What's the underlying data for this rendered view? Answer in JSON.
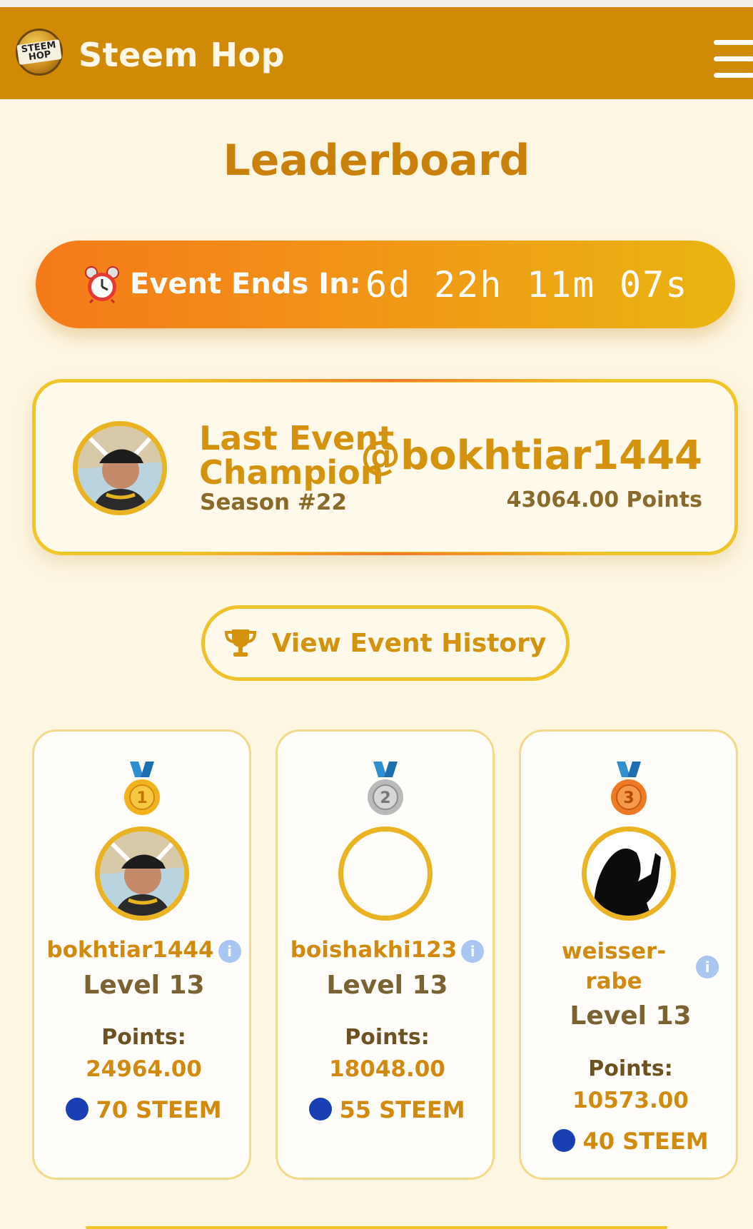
{
  "header": {
    "app_title": "Steem Hop",
    "logo_text": "STEEM HOP",
    "bg_color": "#d18a06"
  },
  "page": {
    "title": "Leaderboard"
  },
  "countdown": {
    "label": "Event Ends In:",
    "days": "6d",
    "hours": "22h",
    "minutes": "11m",
    "seconds": "07s",
    "icon": "alarm-clock-icon"
  },
  "champion": {
    "heading": "Last Event Champion",
    "season": "Season #22",
    "username": "@bokhtiar1444",
    "points": "43064.00 Points"
  },
  "history_button": {
    "label": "View Event History",
    "icon": "trophy-icon"
  },
  "leaders": [
    {
      "rank": "1",
      "username": "bokhtiar1444",
      "level": "Level 13",
      "points_label": "Points:",
      "points": "24964.00",
      "reward": "70 STEEM",
      "medal_color": "#f2b21d"
    },
    {
      "rank": "2",
      "username": "boishakhi123",
      "level": "Level 13",
      "points_label": "Points:",
      "points": "18048.00",
      "reward": "55 STEEM",
      "medal_color": "#b9b9b9"
    },
    {
      "rank": "3",
      "username": "weisser-rabe",
      "username_line1": "weisser-",
      "username_line2": "rabe",
      "level": "Level 13",
      "points_label": "Points:",
      "points": "10573.00",
      "reward": "40 STEEM",
      "medal_color": "#ef7a26"
    }
  ]
}
